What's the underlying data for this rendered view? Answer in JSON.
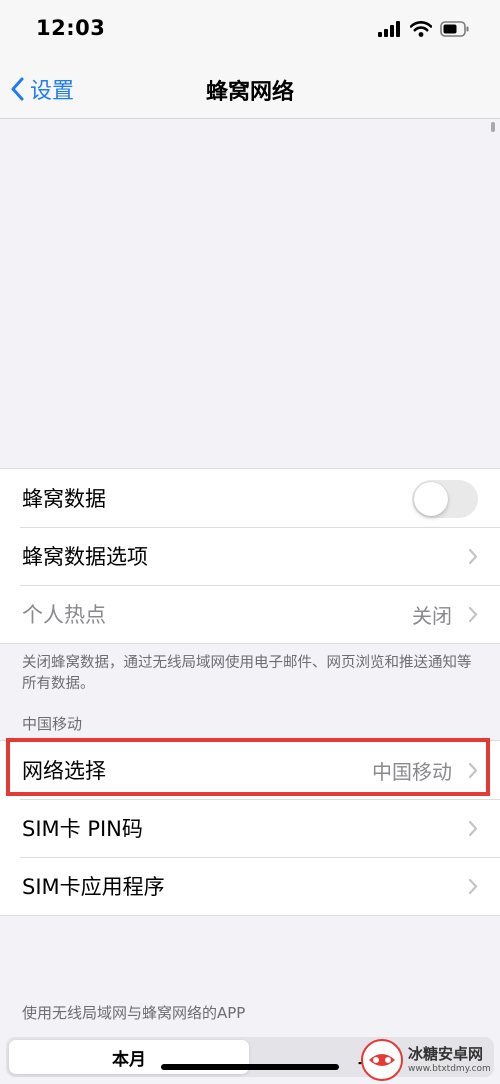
{
  "status_bar": {
    "time": "12:03"
  },
  "nav": {
    "back_label": "设置",
    "title": "蜂窝网络"
  },
  "cellular_group": {
    "rows": [
      {
        "label": "蜂窝数据",
        "toggle_on": false
      },
      {
        "label": "蜂窝数据选项"
      },
      {
        "label": "个人热点",
        "value": "关闭"
      }
    ],
    "footer": "关闭蜂窝数据，通过无线局域网使用电子邮件、网页浏览和推送通知等所有数据。"
  },
  "carrier_section": {
    "header": "中国移动",
    "rows": [
      {
        "label": "网络选择",
        "value": "中国移动"
      },
      {
        "label": "SIM卡 PIN码"
      },
      {
        "label": "SIM卡应用程序"
      }
    ]
  },
  "apps_section": {
    "header": "使用无线局域网与蜂窝网络的APP"
  },
  "segmented_control": {
    "options": [
      "本月",
      "上"
    ],
    "selected": 0
  },
  "watermark": {
    "name": "冰糖安卓网",
    "url": "www.btxtdmy.com"
  },
  "colors": {
    "accent": "#1f7cf2",
    "highlight": "#e53935",
    "secondary_text": "#8a8a8e"
  }
}
